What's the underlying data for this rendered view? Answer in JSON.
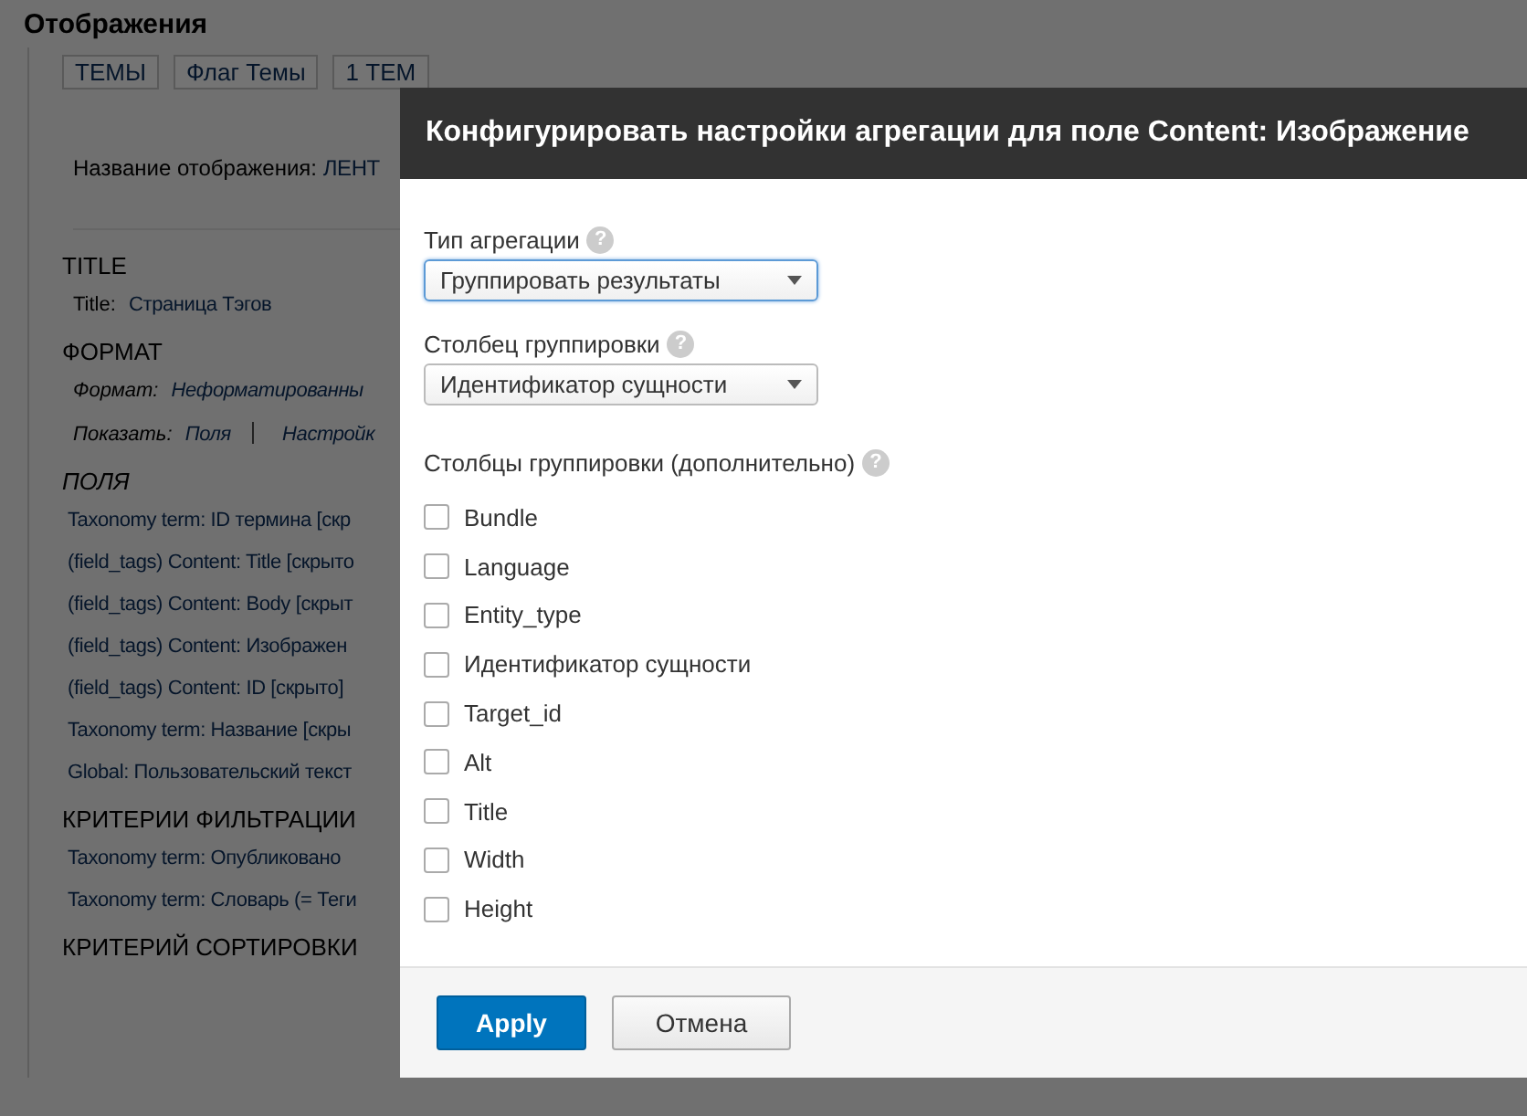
{
  "page": {
    "title": "Отображения"
  },
  "display_tabs": [
    {
      "label": "ТЕМЫ"
    },
    {
      "label": "Флаг Темы"
    },
    {
      "label": "1 ТЕМ"
    }
  ],
  "display_name": {
    "label": "Название отображения:",
    "value": "ЛЕНТ"
  },
  "sections": [
    {
      "heading": "TITLE",
      "italic": false,
      "rows": [
        {
          "label": "Title:",
          "links": [
            "Страница Тэгов"
          ]
        }
      ]
    },
    {
      "heading": "ФОРМАТ",
      "italic": false,
      "rows": [
        {
          "label": "Формат:",
          "italic": true,
          "links": [
            "Неформатированны"
          ]
        },
        {
          "label": "Показать:",
          "italic": true,
          "links": [
            "Поля",
            "Настройк"
          ]
        }
      ]
    },
    {
      "heading": "ПОЛЯ",
      "italic": true,
      "rows": [
        {
          "links": [
            "Taxonomy term: ID термина [скр"
          ]
        },
        {
          "links": [
            "(field_tags) Content: Title [скрыто"
          ]
        },
        {
          "links": [
            "(field_tags) Content: Body [скрыт"
          ]
        },
        {
          "links": [
            "(field_tags) Content: Изображен"
          ]
        },
        {
          "links": [
            "(field_tags) Content: ID [скрыто]"
          ]
        },
        {
          "links": [
            "Taxonomy term: Название [скры"
          ]
        },
        {
          "links": [
            "Global: Пользовательский текст"
          ]
        }
      ]
    },
    {
      "heading": "КРИТЕРИИ ФИЛЬТРАЦИИ",
      "italic": false,
      "rows": [
        {
          "links": [
            "Taxonomy term: Опубликовано"
          ]
        },
        {
          "links": [
            "Taxonomy term: Словарь (= Теги"
          ]
        }
      ]
    },
    {
      "heading": "КРИТЕРИЙ СОРТИРОВКИ",
      "italic": false
    }
  ],
  "dialog": {
    "title": "Конфигурировать настройки агрегации для поле Content: Изображение",
    "fields": [
      {
        "label": "Тип агрегации",
        "help": "?",
        "value": "Группировать результаты",
        "focused": true
      },
      {
        "label": "Столбец группировки",
        "help": "?",
        "value": "Идентификатор сущности",
        "focused": false
      }
    ],
    "checkbox_group": {
      "label": "Столбцы группировки (дополнительно)",
      "help": "?",
      "options": [
        {
          "label": "Bundle",
          "checked": false
        },
        {
          "label": "Language",
          "checked": false
        },
        {
          "label": "Entity_type",
          "checked": false
        },
        {
          "label": "Идентификатор сущности",
          "checked": false
        },
        {
          "label": "Target_id",
          "checked": false
        },
        {
          "label": "Alt",
          "checked": false
        },
        {
          "label": "Title",
          "checked": false
        },
        {
          "label": "Width",
          "checked": false
        },
        {
          "label": "Height",
          "checked": false
        }
      ]
    },
    "buttons": [
      {
        "label": "Apply",
        "kind": "primary"
      },
      {
        "label": "Отмена",
        "kind": "secondary"
      }
    ]
  }
}
